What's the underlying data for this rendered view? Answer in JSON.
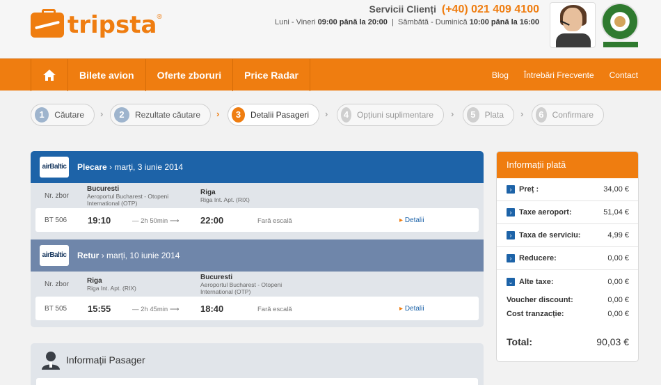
{
  "brand": {
    "name": "tripsta",
    "reg": "®"
  },
  "service": {
    "label": "Servicii Clienți",
    "phone": "(+40) 021 409 4100",
    "hours_weekday_prefix": "Luni - Vineri",
    "hours_weekday": "09:00 până la 20:00",
    "separator": "|",
    "hours_weekend_prefix": "Sâmbătă - Duminică",
    "hours_weekend": "10:00 până la 16:00"
  },
  "nav": {
    "items": [
      "Bilete avion",
      "Oferte zboruri",
      "Price Radar"
    ],
    "links": [
      "Blog",
      "Întrebări Frecvente",
      "Contact"
    ]
  },
  "steps": [
    {
      "num": "1",
      "label": "Căutare"
    },
    {
      "num": "2",
      "label": "Rezultate căutare"
    },
    {
      "num": "3",
      "label": "Detalii Pasageri"
    },
    {
      "num": "4",
      "label": "Opțiuni suplimentare"
    },
    {
      "num": "5",
      "label": "Plata"
    },
    {
      "num": "6",
      "label": "Confirmare"
    }
  ],
  "flights": {
    "col_label": "Nr. zbor",
    "departure": {
      "airline": "airBaltic",
      "title": "Plecare",
      "date": "› marți, 3 iunie 2014",
      "from_city": "Bucuresti",
      "from_airport": "Aeroportul Bucharest - Otopeni International (OTP)",
      "to_city": "Riga",
      "to_airport": "Riga Int. Apt. (RIX)",
      "flight_no": "BT 506",
      "dep_time": "19:10",
      "duration": "— 2h 50min ⟶",
      "arr_time": "22:00",
      "stops": "Fară escală",
      "details": "Detalii"
    },
    "return": {
      "airline": "airBaltic",
      "title": "Retur",
      "date": "› marți, 10 iunie 2014",
      "from_city": "Riga",
      "from_airport": "Riga Int. Apt. (RIX)",
      "to_city": "Bucuresti",
      "to_airport": "Aeroportul Bucharest - Otopeni International (OTP)",
      "flight_no": "BT 505",
      "dep_time": "15:55",
      "duration": "— 2h 45min ⟶",
      "arr_time": "18:40",
      "stops": "Fară escală",
      "details": "Detalii"
    }
  },
  "payment": {
    "title": "Informații plată",
    "rows": [
      {
        "label": "Preț :",
        "value": "34,00 €"
      },
      {
        "label": "Taxe aeroport:",
        "value": "51,04 €"
      },
      {
        "label": "Taxa de serviciu:",
        "value": "4,99 €"
      },
      {
        "label": "Reducere:",
        "value": "0,00 €"
      },
      {
        "label": "Alte taxe:",
        "value": "0,00 €"
      }
    ],
    "voucher_label": "Voucher discount:",
    "voucher_value": "0,00 €",
    "cost_label": "Cost tranzacție:",
    "cost_value": "0,00 €",
    "total_label": "Total:",
    "total_value": "90,03 €"
  },
  "passenger": {
    "title": "Informații Pasager"
  },
  "colors": {
    "accent": "#ef7d10",
    "primary": "#1d63a8",
    "return_header": "#6f86aa"
  }
}
